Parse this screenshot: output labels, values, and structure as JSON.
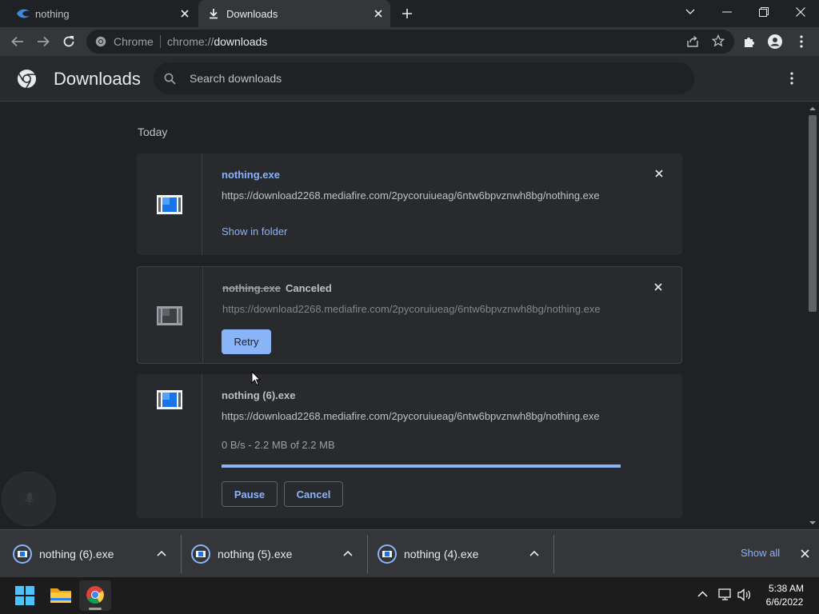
{
  "tabs": [
    {
      "title": "nothing",
      "icon": "mediafire-icon",
      "active": false
    },
    {
      "title": "Downloads",
      "icon": "download-icon",
      "active": true
    }
  ],
  "toolbar": {
    "site_name": "Chrome",
    "url_scheme": "chrome://",
    "url_host": "downloads"
  },
  "header": {
    "title": "Downloads",
    "search_placeholder": "Search downloads"
  },
  "content": {
    "section_label": "Today",
    "downloads": [
      {
        "filename": "nothing.exe",
        "url": "https://download2268.mediafire.com/2pycoruiueag/6ntw6bpvznwh8bg/nothing.exe",
        "action_label": "Show in folder"
      },
      {
        "filename": "nothing.exe",
        "status": "Canceled",
        "url": "https://download2268.mediafire.com/2pycoruiueag/6ntw6bpvznwh8bg/nothing.exe",
        "retry_label": "Retry"
      },
      {
        "filename": "nothing (6).exe",
        "url": "https://download2268.mediafire.com/2pycoruiueag/6ntw6bpvznwh8bg/nothing.exe",
        "progress_text": "0 B/s - 2.2 MB of 2.2 MB",
        "progress_fraction": 1.0,
        "pause_label": "Pause",
        "cancel_label": "Cancel"
      }
    ]
  },
  "shelf": {
    "items": [
      {
        "name": "nothing (6).exe"
      },
      {
        "name": "nothing (5).exe"
      },
      {
        "name": "nothing (4).exe"
      }
    ],
    "show_all_label": "Show all"
  },
  "taskbar": {
    "time": "5:38 AM",
    "date": "6/6/2022"
  },
  "colors": {
    "accent": "#8ab4f8",
    "background": "#202124",
    "card": "#292a2d"
  }
}
